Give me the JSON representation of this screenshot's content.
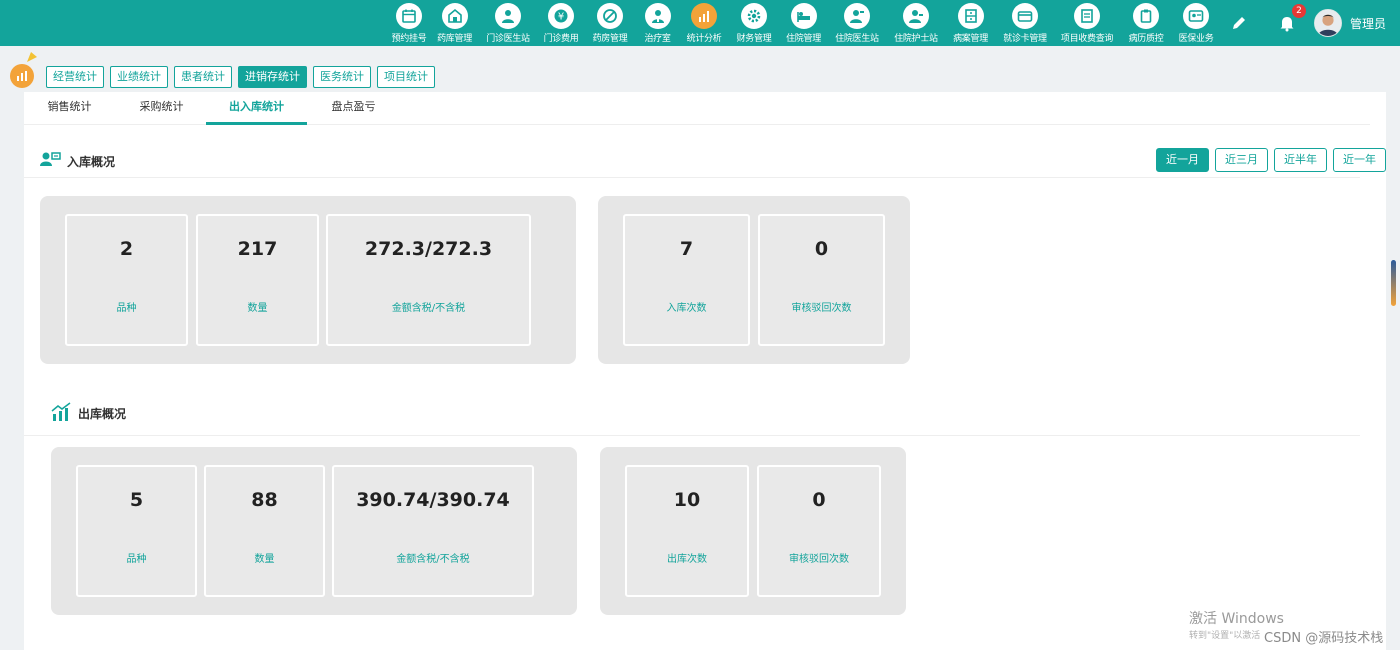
{
  "topnav": {
    "items": [
      {
        "label": "预约挂号",
        "icon": "calendar-icon",
        "active": false
      },
      {
        "label": "药库管理",
        "icon": "warehouse-icon",
        "active": false
      },
      {
        "label": "门诊医生站",
        "icon": "doctor-icon",
        "active": false
      },
      {
        "label": "门诊费用",
        "icon": "yen-icon",
        "active": false
      },
      {
        "label": "药房管理",
        "icon": "pill-icon",
        "active": false
      },
      {
        "label": "治疗室",
        "icon": "nurse-icon",
        "active": false
      },
      {
        "label": "统计分析",
        "icon": "bar-chart-icon",
        "active": true
      },
      {
        "label": "财务管理",
        "icon": "gear-icon",
        "active": false
      },
      {
        "label": "住院管理",
        "icon": "bed-icon",
        "active": false
      },
      {
        "label": "住院医生站",
        "icon": "doctor-card-icon",
        "active": false
      },
      {
        "label": "住院护士站",
        "icon": "nurse-card-icon",
        "active": false
      },
      {
        "label": "病案管理",
        "icon": "file-cabinet-icon",
        "active": false
      },
      {
        "label": "就诊卡管理",
        "icon": "card-icon",
        "active": false
      },
      {
        "label": "项目收费查询",
        "icon": "receipt-icon",
        "active": false
      },
      {
        "label": "病历质控",
        "icon": "clipboard-icon",
        "active": false
      },
      {
        "label": "医保业务",
        "icon": "id-card-icon",
        "active": false
      }
    ],
    "notification_count": "2",
    "username": "管理员"
  },
  "subtabs": [
    {
      "label": "经营统计",
      "active": false
    },
    {
      "label": "业绩统计",
      "active": false
    },
    {
      "label": "患者统计",
      "active": false
    },
    {
      "label": "进销存统计",
      "active": true
    },
    {
      "label": "医务统计",
      "active": false
    },
    {
      "label": "项目统计",
      "active": false
    }
  ],
  "innertabs": [
    {
      "label": "销售统计",
      "active": false
    },
    {
      "label": "采购统计",
      "active": false
    },
    {
      "label": "出入库统计",
      "active": true
    },
    {
      "label": "盘点盈亏",
      "active": false
    }
  ],
  "range_buttons": [
    {
      "label": "近一月",
      "active": true
    },
    {
      "label": "近三月",
      "active": false
    },
    {
      "label": "近半年",
      "active": false
    },
    {
      "label": "近一年",
      "active": false
    }
  ],
  "inbound": {
    "title": "入库概况",
    "cards": [
      {
        "value": "2",
        "label": "品种"
      },
      {
        "value": "217",
        "label": "数量"
      },
      {
        "value": "272.3/272.3",
        "label": "金额含税/不含税"
      },
      {
        "value": "7",
        "label": "入库次数"
      },
      {
        "value": "0",
        "label": "审核驳回次数"
      }
    ]
  },
  "outbound": {
    "title": "出库概况",
    "cards": [
      {
        "value": "5",
        "label": "品种"
      },
      {
        "value": "88",
        "label": "数量"
      },
      {
        "value": "390.74/390.74",
        "label": "金额含税/不含税"
      },
      {
        "value": "10",
        "label": "出库次数"
      },
      {
        "value": "0",
        "label": "审核驳回次数"
      }
    ]
  },
  "watermark": {
    "line1": "激活 Windows",
    "line2": "转到\"设置\"以激活",
    "source": "CSDN @源码技术栈"
  },
  "colors": {
    "primary": "#13a49b",
    "accent": "#f3a339",
    "badge": "#e53935"
  }
}
